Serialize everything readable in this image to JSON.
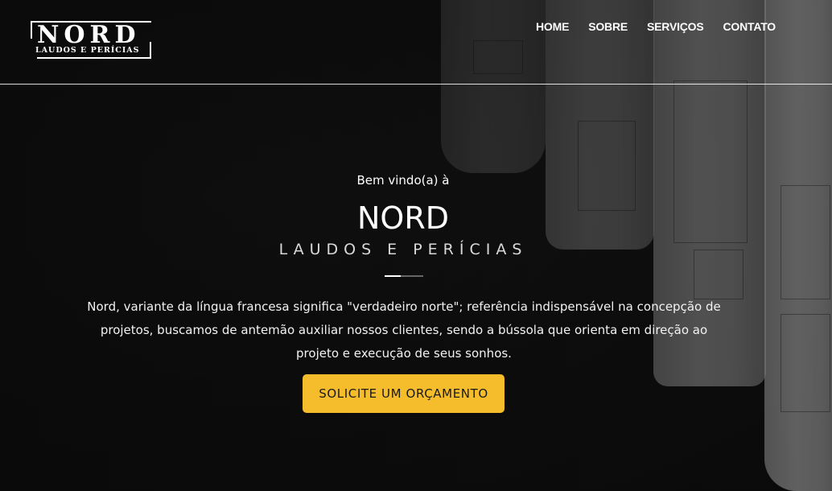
{
  "header": {
    "logo": {
      "name": "NORD",
      "subtitle": "LAUDOS E PERÍCIAS"
    },
    "nav": [
      {
        "label": "HOME"
      },
      {
        "label": "SOBRE"
      },
      {
        "label": "SERVIÇOS"
      },
      {
        "label": "CONTATO"
      }
    ]
  },
  "hero": {
    "welcome": "Bem vindo(a) à",
    "brand": "NORD",
    "tagline": "LAUDOS E PERÍCIAS",
    "description": "Nord, variante da língua francesa significa \"verdadeiro norte\"; referência indispensável na concepção de projetos, buscamos de antemão auxiliar nossos clientes, sendo a bússola que orienta em direção ao projeto e execução de seus sonhos.",
    "cta_label": "SOLICITE UM ORÇAMENTO"
  },
  "colors": {
    "accent": "#f5bd2b",
    "background": "#0d0d0d"
  }
}
